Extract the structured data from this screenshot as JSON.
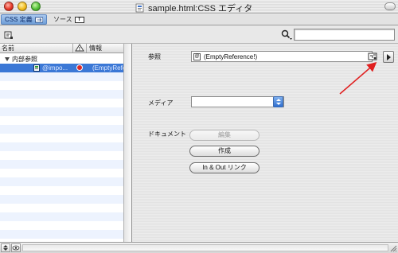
{
  "window": {
    "title": "sample.html:CSS エディタ"
  },
  "tabs": [
    {
      "label": "CSS 定義",
      "icon": "css-tab-icon"
    },
    {
      "label": "ソース",
      "icon_text": "T"
    }
  ],
  "search": {
    "placeholder": "",
    "value": ""
  },
  "list": {
    "columns": {
      "name": "名前",
      "info": "情報"
    },
    "group_label": "内部参照",
    "selected_item": {
      "name": "@impo...",
      "info": "(EmptyRefe"
    }
  },
  "inspector": {
    "reference_label": "参照",
    "reference_value": "(EmptyReference!)",
    "media_label": "メディア",
    "media_value": "",
    "document_label": "ドキュメント",
    "buttons": {
      "edit": "編集",
      "create": "作成",
      "inout": "In & Out リンク"
    }
  },
  "colors": {
    "selection": "#3b78d6",
    "annotation_arrow": "#e02020"
  }
}
